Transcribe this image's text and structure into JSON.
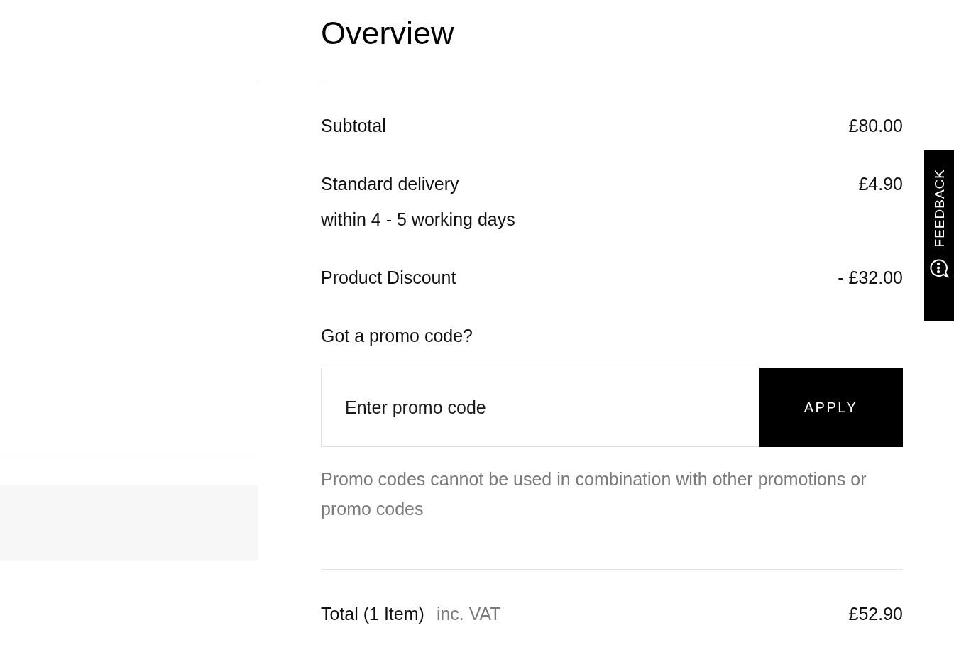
{
  "overview": {
    "title": "Overview",
    "lines": [
      {
        "label": "Subtotal",
        "amount": "£80.00"
      },
      {
        "label": "Standard delivery",
        "amount": "£4.90",
        "note": "within 4 - 5 working days"
      },
      {
        "label": "Product Discount",
        "amount": "- £32.00"
      }
    ],
    "promo": {
      "question": "Got a promo code?",
      "placeholder": "Enter promo code",
      "button": "APPLY",
      "disclaimer": "Promo codes cannot be used in combination with other promotions or promo codes"
    },
    "total": {
      "label": "Total (1 Item)",
      "vat_note": "inc. VAT",
      "amount": "£52.90"
    }
  },
  "feedback_tab": {
    "label": "FEEDBACK"
  }
}
